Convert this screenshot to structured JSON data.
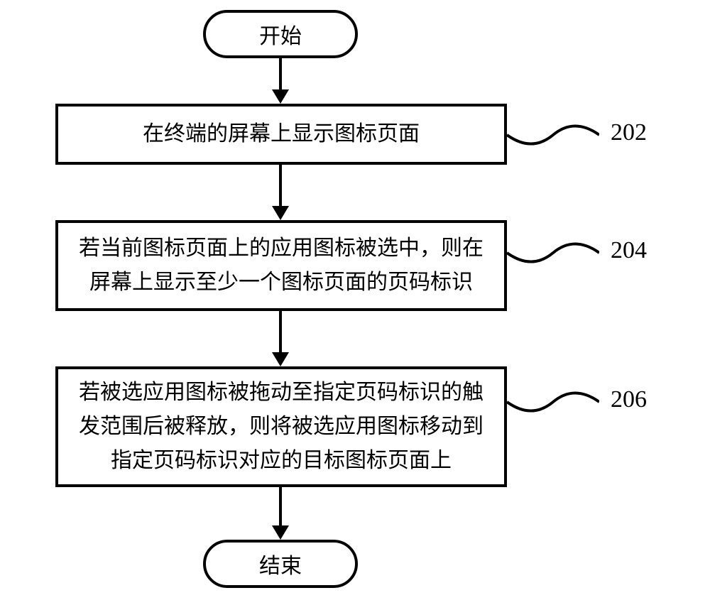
{
  "flowchart": {
    "start": "开始",
    "end": "结束",
    "steps": [
      {
        "id": "202",
        "text": "在终端的屏幕上显示图标页面"
      },
      {
        "id": "204",
        "text": "若当前图标页面上的应用图标被选中，则在屏幕上显示至少一个图标页面的页码标识"
      },
      {
        "id": "206",
        "text": "若被选应用图标被拖动至指定页码标识的触发范围后被释放，则将被选应用图标移动到指定页码标识对应的目标图标页面上"
      }
    ]
  }
}
